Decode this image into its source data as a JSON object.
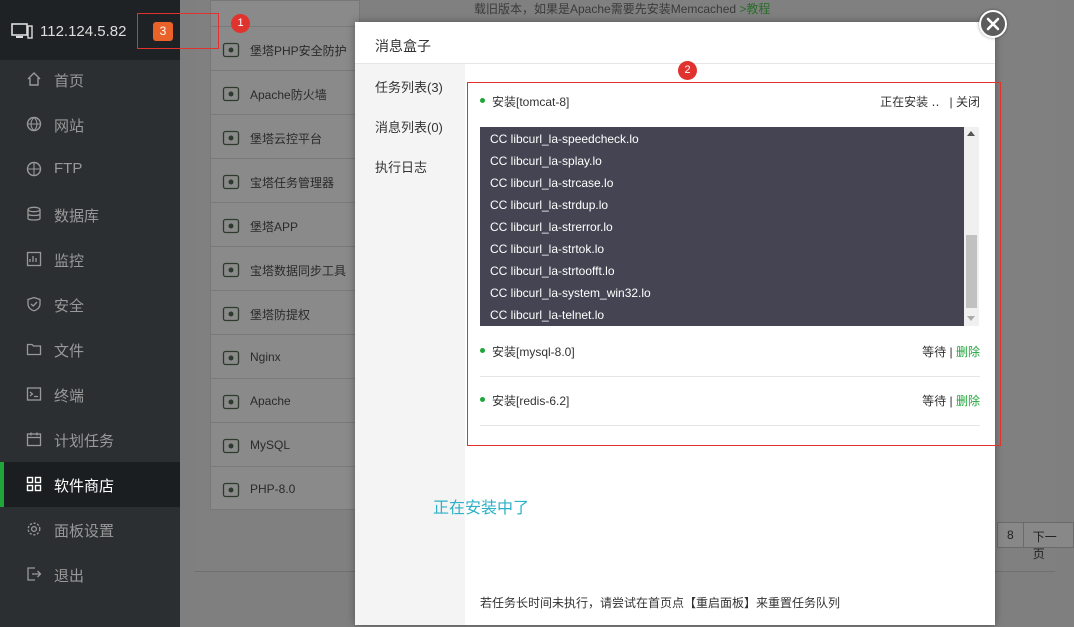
{
  "sidebar": {
    "host_ip": "112.124.5.82",
    "notice_count": "3",
    "items": [
      {
        "label": "首页",
        "icon": "home-icon"
      },
      {
        "label": "网站",
        "icon": "globe-icon"
      },
      {
        "label": "FTP",
        "icon": "ftp-icon"
      },
      {
        "label": "数据库",
        "icon": "database-icon"
      },
      {
        "label": "监控",
        "icon": "monitor-icon"
      },
      {
        "label": "安全",
        "icon": "shield-icon"
      },
      {
        "label": "文件",
        "icon": "folder-icon"
      },
      {
        "label": "终端",
        "icon": "terminal-icon"
      },
      {
        "label": "计划任务",
        "icon": "calendar-icon"
      },
      {
        "label": "软件商店",
        "icon": "grid-icon",
        "active": true
      },
      {
        "label": "面板设置",
        "icon": "gear-icon"
      },
      {
        "label": "退出",
        "icon": "logout-icon"
      }
    ]
  },
  "background": {
    "top_note": "载旧版本，如果是Apache需要先安装Memcached",
    "top_note_link": ">教程",
    "software": [
      {
        "name": "堡塔PHP安全防护",
        "icon": "php-guard-icon"
      },
      {
        "name": "Apache防火墙",
        "icon": "waf-icon"
      },
      {
        "name": "堡塔云控平台",
        "icon": "cloud-control-icon"
      },
      {
        "name": "宝塔任务管理器",
        "icon": "task-manager-icon"
      },
      {
        "name": "堡塔APP",
        "icon": "app-icon"
      },
      {
        "name": "宝塔数据同步工具",
        "icon": "data-sync-icon"
      },
      {
        "name": "堡塔防提权",
        "icon": "anti-privilege-icon"
      },
      {
        "name": "Nginx",
        "icon": "nginx-icon"
      },
      {
        "name": "Apache",
        "icon": "apache-icon"
      },
      {
        "name": "MySQL",
        "icon": "mysql-icon"
      },
      {
        "name": "PHP-8.0",
        "icon": "php-icon"
      }
    ],
    "pager": [
      "8",
      "下一页"
    ]
  },
  "modal": {
    "title": "消息盒子",
    "tabs": [
      "任务列表(3)",
      "消息列表(0)",
      "执行日志"
    ],
    "tasks": [
      {
        "name": "安装[tomcat-8]",
        "status": "正在安装 ‥",
        "separator": "|",
        "action": "关闭"
      },
      {
        "name": "安装[mysql-8.0]",
        "status": "等待",
        "separator": "|",
        "action": "删除"
      },
      {
        "name": "安装[redis-6.2]",
        "status": "等待",
        "separator": "|",
        "action": "删除"
      }
    ],
    "log_lines": [
      "CC libcurl_la-speedcheck.lo",
      "CC libcurl_la-splay.lo",
      "CC libcurl_la-strcase.lo",
      "CC libcurl_la-strdup.lo",
      "CC libcurl_la-strerror.lo",
      "CC libcurl_la-strtok.lo",
      "CC libcurl_la-strtoofft.lo",
      "CC libcurl_la-system_win32.lo",
      "CC libcurl_la-telnet.lo"
    ],
    "footer_note": "若任务长时间未执行，请尝试在首页点【重启面板】来重置任务队列"
  },
  "annotations": {
    "marker_1": "1",
    "marker_2": "2",
    "note": "正在安装中了"
  },
  "colors": {
    "brand_green": "#20a53a",
    "annotation_red": "#e0332d",
    "annotation_text": "#2bb1c8",
    "badge_orange": "#e8622a"
  }
}
